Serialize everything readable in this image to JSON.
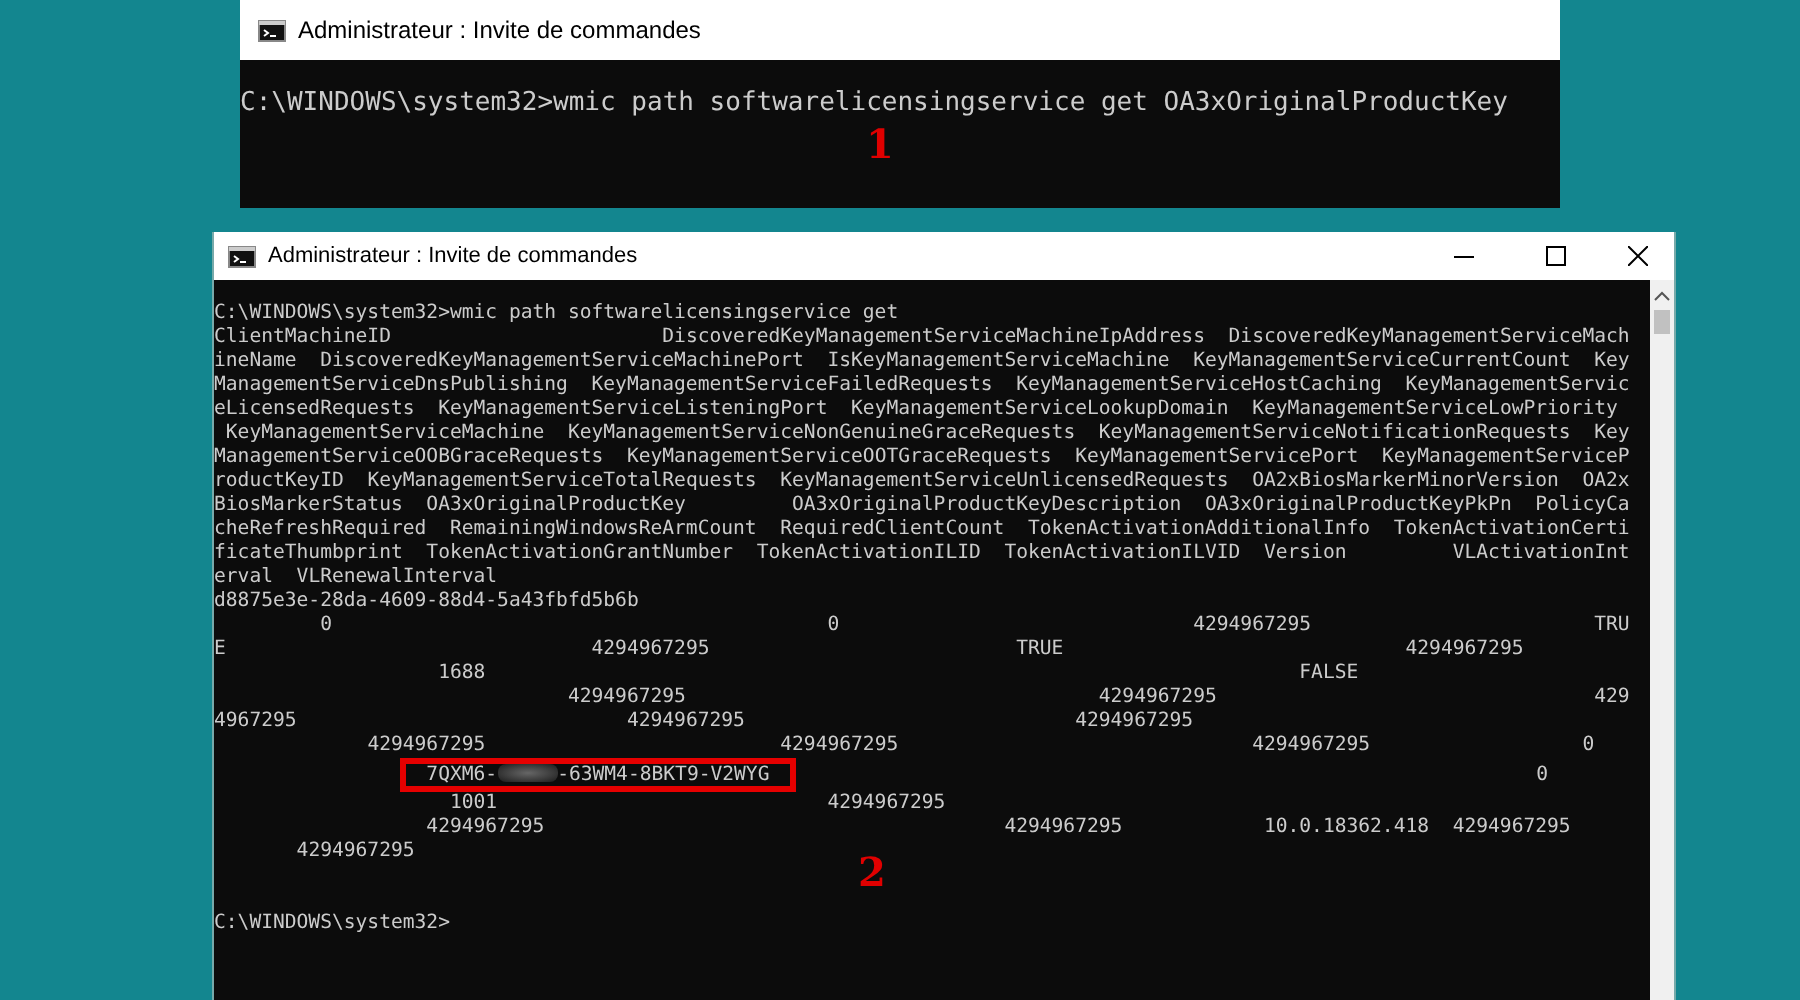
{
  "windows": [
    {
      "title": "Administrateur : Invite de commandes",
      "window_controls": false,
      "scrollbar": false,
      "marker": "1",
      "lines": [
        {
          "kind": "command",
          "text": "C:\\WINDOWS\\system32>wmic path softwarelicensingservice get OA3xOriginalProductKey"
        }
      ]
    },
    {
      "title": "Administrateur : Invite de commandes",
      "window_controls": true,
      "scrollbar": true,
      "marker": "2",
      "lines": [
        {
          "kind": "command",
          "text": "C:\\WINDOWS\\system32>wmic path softwarelicensingservice get"
        },
        {
          "kind": "header",
          "text": "ClientMachineID                       DiscoveredKeyManagementServiceMachineIpAddress  DiscoveredKeyManagementServiceMach"
        },
        {
          "kind": "header",
          "text": "ineName  DiscoveredKeyManagementServiceMachinePort  IsKeyManagementServiceMachine  KeyManagementServiceCurrentCount  Key"
        },
        {
          "kind": "header",
          "text": "ManagementServiceDnsPublishing  KeyManagementServiceFailedRequests  KeyManagementServiceHostCaching  KeyManagementServic"
        },
        {
          "kind": "header",
          "text": "eLicensedRequests  KeyManagementServiceListeningPort  KeyManagementServiceLookupDomain  KeyManagementServiceLowPriority"
        },
        {
          "kind": "header",
          "text": " KeyManagementServiceMachine  KeyManagementServiceNonGenuineGraceRequests  KeyManagementServiceNotificationRequests  Key"
        },
        {
          "kind": "header",
          "text": "ManagementServiceOOBGraceRequests  KeyManagementServiceOOTGraceRequests  KeyManagementServicePort  KeyManagementServiceP"
        },
        {
          "kind": "header",
          "text": "roductKeyID  KeyManagementServiceTotalRequests  KeyManagementServiceUnlicensedRequests  OA2xBiosMarkerMinorVersion  OA2x"
        },
        {
          "kind": "header",
          "text": "BiosMarkerStatus  OA3xOriginalProductKey         OA3xOriginalProductKeyDescription  OA3xOriginalProductKeyPkPn  PolicyCa"
        },
        {
          "kind": "header",
          "text": "cheRefreshRequired  RemainingWindowsReArmCount  RequiredClientCount  TokenActivationAdditionalInfo  TokenActivationCerti"
        },
        {
          "kind": "header",
          "text": "ficateThumbprint  TokenActivationGrantNumber  TokenActivationILID  TokenActivationILVID  Version         VLActivationInt"
        },
        {
          "kind": "header",
          "text": "erval  VLRenewalInterval"
        },
        {
          "kind": "value",
          "text": "d8875e3e-28da-4609-88d4-5a43fbfd5b6b"
        },
        {
          "kind": "value",
          "text": "         0                                          0                              4294967295                        TRU"
        },
        {
          "kind": "value",
          "text": "E                               4294967295                          TRUE                             4294967295"
        },
        {
          "kind": "value",
          "text": "                   1688                                                                     FALSE"
        },
        {
          "kind": "value",
          "text": "                              4294967295                                   4294967295                                429"
        },
        {
          "kind": "value",
          "text": "4967295                            4294967295                            4294967295"
        },
        {
          "kind": "value",
          "text": "             4294967295                         4294967295                              4294967295                  0"
        },
        {
          "kind": "key",
          "key_start": "                  7QXM6-",
          "key_end": "-63WM4-8BKT9-V2WYG",
          "highlighted": true,
          "rest": "                                                                 0"
        },
        {
          "kind": "value",
          "text": "                    1001                            4294967295"
        },
        {
          "kind": "value",
          "text": "                  4294967295                                       4294967295            10.0.18362.418  4294967295"
        },
        {
          "kind": "value",
          "text": "       4294967295"
        },
        {
          "kind": "blank"
        },
        {
          "kind": "blank"
        },
        {
          "kind": "prompt",
          "text": "C:\\WINDOWS\\system32>"
        }
      ]
    }
  ]
}
